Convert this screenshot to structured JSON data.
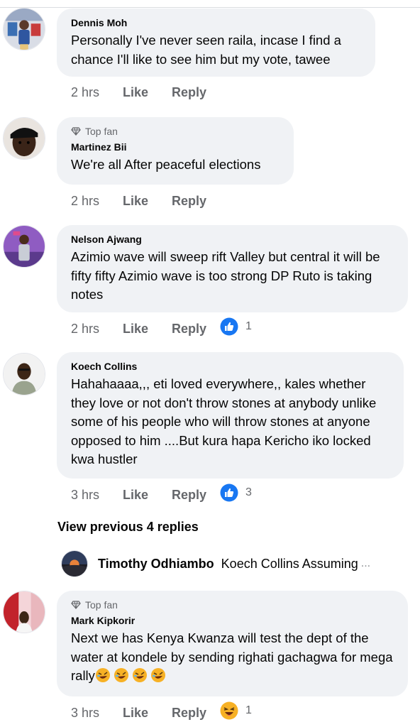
{
  "comments": [
    {
      "author": "Dennis Moh",
      "badge": "",
      "text": "Personally I've never seen raila, incase I find a chance I'll like to see him but my vote, tawee",
      "time": "2 hrs",
      "like_label": "Like",
      "reply_label": "Reply",
      "reaction": null
    },
    {
      "author": "Martinez Bii",
      "badge": "Top fan",
      "text": "We're all After peaceful elections",
      "time": "2 hrs",
      "like_label": "Like",
      "reply_label": "Reply",
      "reaction": null
    },
    {
      "author": "Nelson Ajwang",
      "badge": "",
      "text": "Azimio wave will sweep rift Valley but central it will be fifty fifty Azimio wave is too strong DP Ruto is taking notes",
      "time": "2 hrs",
      "like_label": "Like",
      "reply_label": "Reply",
      "reaction": {
        "icon": "like-reaction-icon",
        "count": "1"
      }
    },
    {
      "author": "Koech Collins",
      "badge": "",
      "text": "Hahahaaaa,,, eti loved everywhere,, kales whether they love or not don't throw stones at anybody unlike some of his people who will throw stones at anyone opposed to him ....But kura hapa Kericho iko locked kwa hustler",
      "time": "3 hrs",
      "like_label": "Like",
      "reply_label": "Reply",
      "reaction": {
        "icon": "like-reaction-icon",
        "count": "3"
      }
    },
    {
      "author": "Mark Kipkorir",
      "badge": "Top fan",
      "text": "Next we has Kenya Kwanza will test the dept of the water at kondele by sending righati gachagwa for mega rally",
      "emojis": [
        "rofl-emoji-icon",
        "rofl-emoji-icon",
        "rofl-emoji-icon",
        "rofl-emoji-icon"
      ],
      "time": "3 hrs",
      "like_label": "Like",
      "reply_label": "Reply",
      "reaction": {
        "icon": "haha-reaction-icon",
        "count": "1"
      }
    }
  ],
  "view_previous": "View previous 4 replies",
  "reply_preview": {
    "author": "Timothy Odhiambo",
    "snippet": "Koech Collins Assuming",
    "ellipsis": "..."
  },
  "colors": {
    "bubble": "#f0f2f5",
    "secondary_text": "#65676b",
    "like_blue": "#1877f2",
    "haha_yellow": "#f7b125"
  }
}
